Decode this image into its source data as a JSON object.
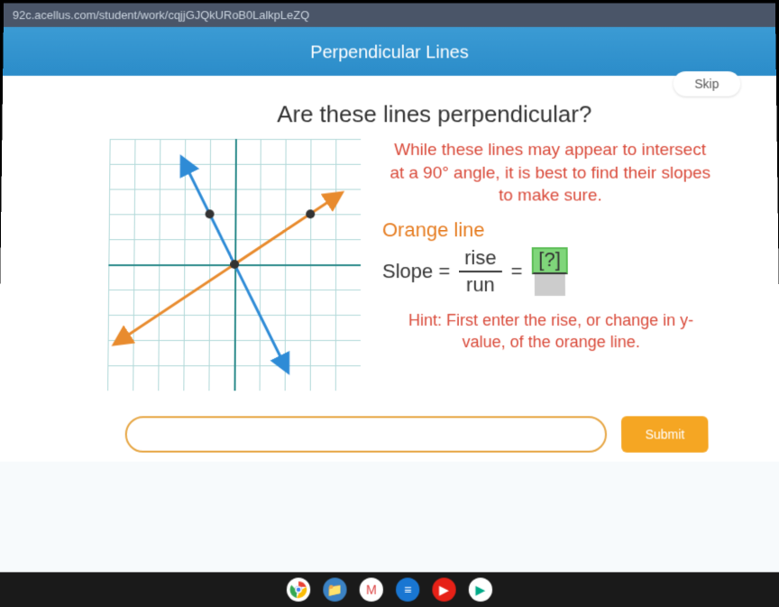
{
  "url": "92c.acellus.com/student/work/cqjjGJQkURoB0LalkpLeZQ",
  "header": {
    "title": "Perpendicular Lines"
  },
  "buttons": {
    "skip": "Skip",
    "submit": "Submit"
  },
  "question": "Are these lines perpendicular?",
  "explain": "While these lines may appear to intersect at a 90° angle, it is best to find their slopes to make sure.",
  "orange_label": "Orange line",
  "slope": {
    "label": "Slope =",
    "rise": "rise",
    "run": "run",
    "eq": "=",
    "answer_placeholder": "[?]"
  },
  "hint": "Hint: First enter the rise, or change in y-value, of the orange line.",
  "input": {
    "value": "",
    "placeholder": ""
  },
  "chart_data": {
    "type": "line",
    "title": "",
    "xlim": [
      -5,
      5
    ],
    "ylim": [
      -5,
      5
    ],
    "grid": true,
    "series": [
      {
        "name": "blue",
        "color": "#2e8bd6",
        "points": [
          [
            -2,
            4
          ],
          [
            0,
            0
          ],
          [
            2,
            -4
          ]
        ],
        "arrows": "both"
      },
      {
        "name": "orange",
        "color": "#e88b2e",
        "points": [
          [
            -4.5,
            -3
          ],
          [
            0,
            0
          ],
          [
            4,
            2.67
          ]
        ],
        "arrows": "both",
        "marked_points": [
          [
            -2,
            2
          ],
          [
            3,
            2
          ]
        ]
      }
    ],
    "dots": [
      [
        -2,
        2
      ],
      [
        0,
        0
      ],
      [
        3,
        2
      ]
    ]
  },
  "taskbar": {
    "icons": [
      "chrome",
      "files",
      "gmail",
      "docs",
      "youtube",
      "play"
    ]
  }
}
